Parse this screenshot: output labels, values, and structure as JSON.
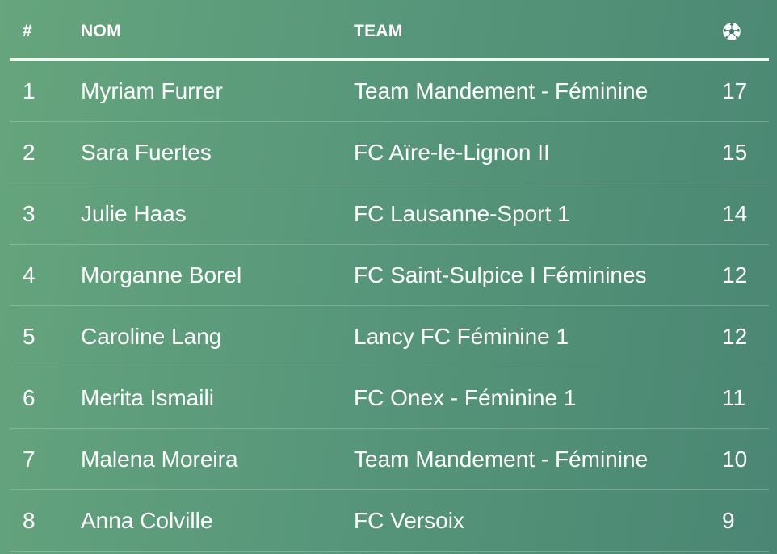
{
  "table": {
    "headers": {
      "rank": "#",
      "name": "NOM",
      "team": "TEAM",
      "goals_icon": "soccer-ball-icon"
    },
    "rows": [
      {
        "rank": "1",
        "name": "Myriam Furrer",
        "team": "Team Mandement - Féminine",
        "goals": "17"
      },
      {
        "rank": "2",
        "name": "Sara Fuertes",
        "team": "FC Aïre-le-Lignon II",
        "goals": "15"
      },
      {
        "rank": "3",
        "name": "Julie Haas",
        "team": "FC Lausanne-Sport 1",
        "goals": "14"
      },
      {
        "rank": "4",
        "name": "Morganne Borel",
        "team": "FC Saint-Sulpice I Féminines",
        "goals": "12"
      },
      {
        "rank": "5",
        "name": "Caroline Lang",
        "team": "Lancy FC Féminine 1",
        "goals": "12"
      },
      {
        "rank": "6",
        "name": "Merita Ismaili",
        "team": "FC Onex - Féminine 1",
        "goals": "11"
      },
      {
        "rank": "7",
        "name": "Malena Moreira",
        "team": "Team Mandement - Féminine",
        "goals": "10"
      },
      {
        "rank": "8",
        "name": "Anna Colville",
        "team": "FC Versoix",
        "goals": "9"
      }
    ]
  }
}
